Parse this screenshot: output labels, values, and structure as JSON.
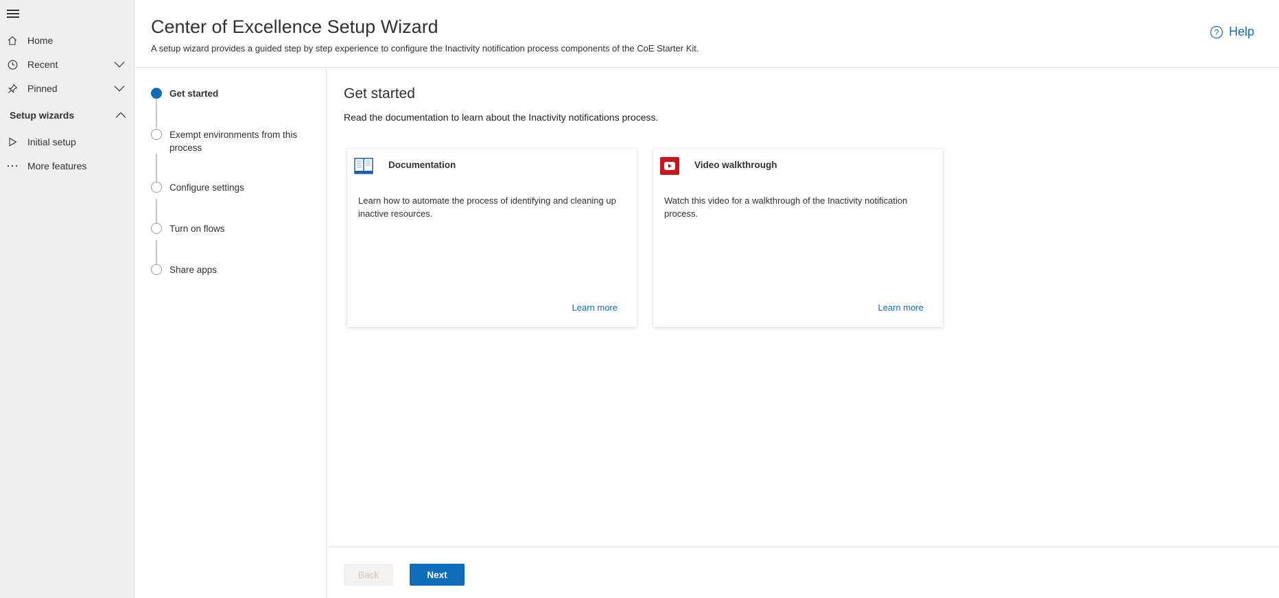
{
  "sidebar": {
    "items": [
      {
        "label": "Home",
        "icon": "home-icon"
      },
      {
        "label": "Recent",
        "icon": "clock-icon"
      },
      {
        "label": "Pinned",
        "icon": "pin-icon"
      }
    ],
    "section_label": "Setup wizards",
    "section_items": [
      {
        "label": "Initial setup",
        "icon": "play-icon"
      },
      {
        "label": "More features",
        "icon": "more-icon"
      }
    ]
  },
  "header": {
    "title": "Center of Excellence Setup Wizard",
    "subtitle": "A setup wizard provides a guided step by step experience to configure the Inactivity notification process components of the CoE Starter Kit.",
    "help_label": "Help"
  },
  "steps": [
    {
      "label": "Get started",
      "active": true
    },
    {
      "label": "Exempt environments from this process",
      "active": false
    },
    {
      "label": "Configure settings",
      "active": false
    },
    {
      "label": "Turn on flows",
      "active": false
    },
    {
      "label": "Share apps",
      "active": false
    }
  ],
  "main": {
    "title": "Get started",
    "description": "Read the documentation to learn about the Inactivity notifications process.",
    "cards": [
      {
        "title": "Documentation",
        "icon": "book-icon",
        "description": "Learn how to automate the process of identifying and cleaning up inactive resources.",
        "link_label": "Learn more"
      },
      {
        "title": "Video walkthrough",
        "icon": "video-icon",
        "description": "Watch this video for a walkthrough of the Inactivity notification process.",
        "link_label": "Learn more"
      }
    ]
  },
  "footer": {
    "back_label": "Back",
    "next_label": "Next"
  },
  "colors": {
    "accent": "#0f6cbd",
    "sidebar_bg": "#efefef",
    "video_red": "#d12d2d"
  }
}
